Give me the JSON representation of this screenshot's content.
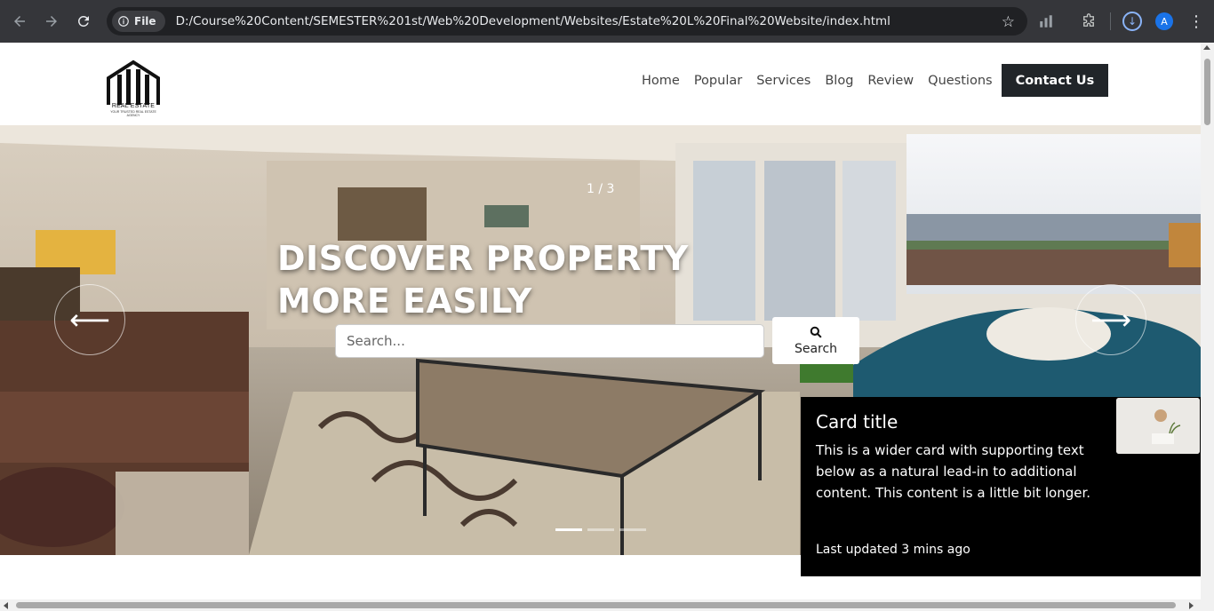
{
  "browser": {
    "file_chip_label": "File",
    "url": "D:/Course%20Content/SEMESTER%201st/Web%20Development/Websites/Estate%20L%20Final%20Website/index.html",
    "profile_initial": "A"
  },
  "site": {
    "logo": {
      "name": "REAL ESTATE",
      "tagline": "YOUR TRUSTED REAL ESTATE AGENCY"
    },
    "nav": {
      "items": [
        {
          "label": "Home"
        },
        {
          "label": "Popular"
        },
        {
          "label": "Services"
        },
        {
          "label": "Blog"
        },
        {
          "label": "Review"
        },
        {
          "label": "Questions"
        }
      ],
      "contact_label": "Contact Us"
    },
    "hero": {
      "slide_counter": "1 / 3",
      "headline_line1": "DISCOVER PROPERTY",
      "headline_line2": "MORE EASILY",
      "search_placeholder": "Search...",
      "search_button": "Search",
      "indicators": [
        true,
        false,
        false
      ]
    },
    "card": {
      "title": "Card title",
      "text": "This is a wider card with supporting text below as a natural lead-in to additional content. This content is a little bit longer.",
      "footer": "Last updated 3 mins ago"
    }
  },
  "icons": {
    "back": "arrow-left-icon",
    "forward": "arrow-right-icon",
    "reload": "reload-icon",
    "info": "info-icon",
    "bookmark": "star-icon",
    "performance": "bar-chart-icon",
    "extensions": "puzzle-icon",
    "download": "download-icon",
    "menu": "kebab-menu-icon",
    "search": "magnifier-icon",
    "prev": "carousel-prev-icon",
    "next": "carousel-next-icon"
  }
}
